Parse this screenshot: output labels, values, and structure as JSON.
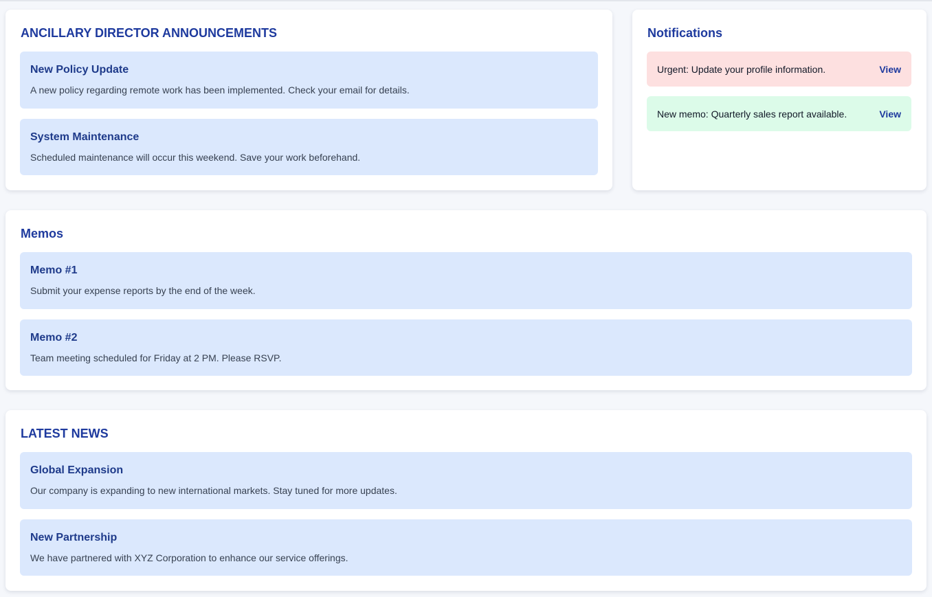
{
  "announcements": {
    "title": "ANCILLARY DIRECTOR ANNOUNCEMENTS",
    "items": [
      {
        "title": "New Policy Update",
        "text": "A new policy regarding remote work has been implemented. Check your email for details."
      },
      {
        "title": "System Maintenance",
        "text": "Scheduled maintenance will occur this weekend. Save your work beforehand."
      }
    ]
  },
  "notifications": {
    "title": "Notifications",
    "items": [
      {
        "text": "Urgent: Update your profile information.",
        "action": "View",
        "color": "#fde0e0"
      },
      {
        "text": "New memo: Quarterly sales report available.",
        "action": "View",
        "color": "#dcfbe9"
      }
    ]
  },
  "memos": {
    "title": "Memos",
    "items": [
      {
        "title": "Memo #1",
        "text": "Submit your expense reports by the end of the week."
      },
      {
        "title": "Memo #2",
        "text": "Team meeting scheduled for Friday at 2 PM. Please RSVP."
      }
    ]
  },
  "news": {
    "title": "LATEST NEWS",
    "items": [
      {
        "title": "Global Expansion",
        "text": "Our company is expanding to new international markets. Stay tuned for more updates."
      },
      {
        "title": "New Partnership",
        "text": "We have partnered with XYZ Corporation to enhance our service offerings."
      }
    ]
  },
  "theme": {
    "accent": "#1e3a9e",
    "item_background": "#dbe8fd",
    "page_background": "#f5f7fb"
  }
}
